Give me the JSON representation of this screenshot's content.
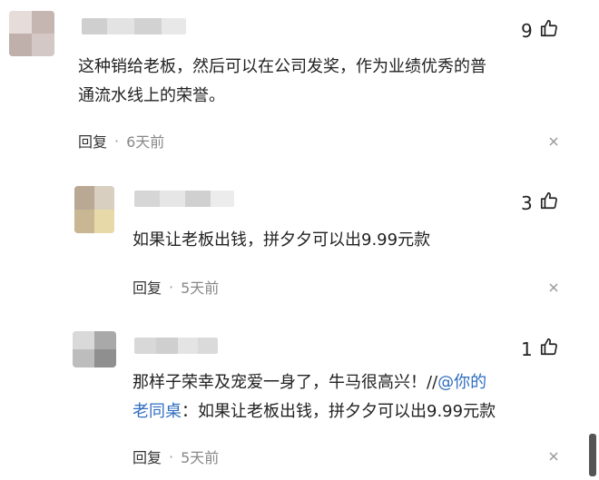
{
  "comments": [
    {
      "likes": "9",
      "text": "这种销给老板，然后可以在公司发奖，作为业绩优秀的普\n通流水线上的荣誉。",
      "reply_label": "回复",
      "separator": "·",
      "time": "6天前"
    },
    {
      "likes": "3",
      "text": "如果让老板出钱，拼夕夕可以出9.99元款",
      "reply_label": "回复",
      "separator": "·",
      "time": "5天前"
    },
    {
      "likes": "1",
      "text_before": "那样子荣幸及宠爱一身了，牛马很高兴！//",
      "mention": "@你的\n老同桌",
      "text_after": "：如果让老板出钱，拼夕夕可以出9.99元款",
      "reply_label": "回复",
      "separator": "·",
      "time": "5天前"
    }
  ],
  "icons": {
    "like": "thumbs-up-icon",
    "close": "close-icon"
  },
  "colors": {
    "mention": "#2f6ec0",
    "time": "#888888"
  }
}
